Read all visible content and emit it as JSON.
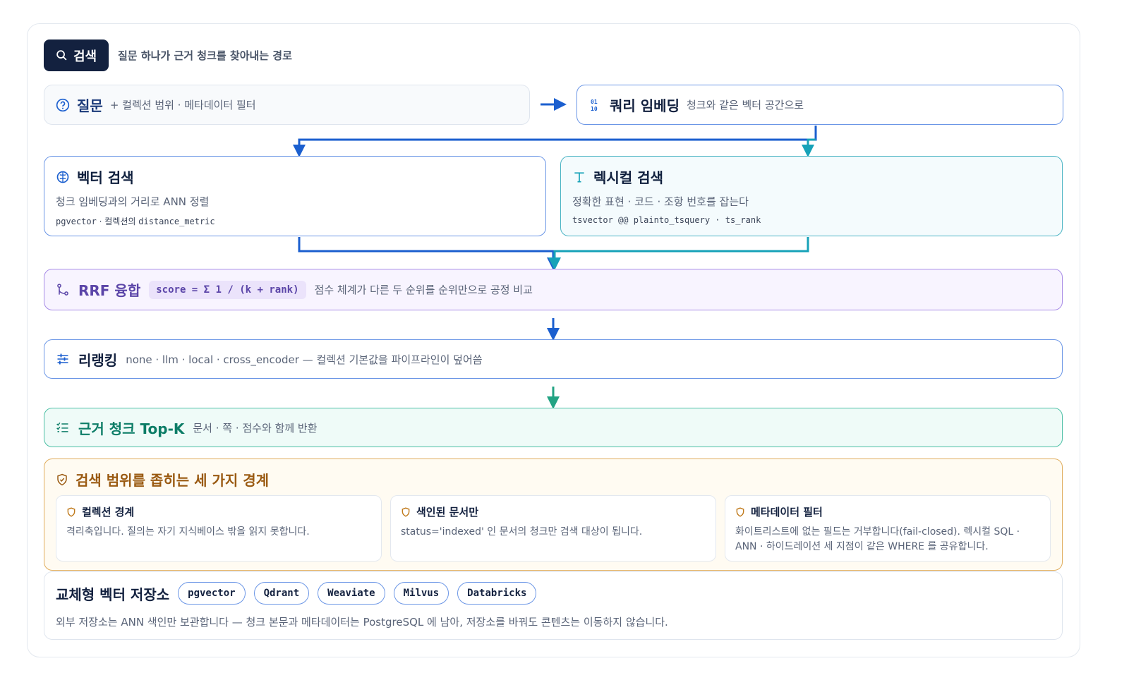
{
  "header": {
    "badge_label": "검색",
    "subtitle": "질문 하나가 근거 청크를 찾아내는 경로"
  },
  "question": {
    "title": "질문",
    "detail": "+ 컬렉션 범위 · 메타데이터 필터"
  },
  "query_embedding": {
    "title": "쿼리 임베딩",
    "detail": "청크와 같은 벡터 공간으로"
  },
  "vector_search": {
    "title": "벡터 검색",
    "detail": "청크 임베딩과의 거리로 ANN 정렬",
    "code_a": "pgvector",
    "code_b": "컬렉션의",
    "code_c": "distance_metric"
  },
  "lexical_search": {
    "title": "렉시컬 검색",
    "detail": "정확한 표현 · 코드 · 조항 번호를 잡는다",
    "code": "tsvector @@ plainto_tsquery · ts_rank"
  },
  "rrf": {
    "title": "RRF 융합",
    "formula": "score = Σ 1 / (k + rank)",
    "detail": "점수 체계가 다른 두 순위를 순위만으로 공정 비교"
  },
  "rerank": {
    "title": "리랭킹",
    "detail": "none · llm · local · cross_encoder — 컬렉션 기본값을 파이프라인이 덮어씀"
  },
  "topk": {
    "title": "근거 청크 Top-K",
    "detail": "문서 · 쪽 · 점수와 함께 반환"
  },
  "boundaries": {
    "title": "검색 범위를 좁히는 세 가지 경계",
    "cards": [
      {
        "title": "컬렉션 경계",
        "text": "격리축입니다. 질의는 자기 지식베이스 밖을 읽지 못합니다."
      },
      {
        "title": "색인된 문서만",
        "text": "status='indexed' 인 문서의 청크만 검색 대상이 됩니다."
      },
      {
        "title": "메타데이터 필터",
        "text": "화이트리스트에 없는 필드는 거부합니다(fail-closed). 렉시컬 SQL · ANN · 하이드레이션 세 지점이 같은 WHERE 를 공유합니다."
      }
    ]
  },
  "stores": {
    "title": "교체형 벡터 저장소",
    "items": [
      "pgvector",
      "Qdrant",
      "Weaviate",
      "Milvus",
      "Databricks"
    ],
    "note": "외부 저장소는 ANN 색인만 보관합니다 — 청크 본문과 메타데이터는 PostgreSQL 에 남아, 저장소를 바꿔도 콘텐츠는 이동하지 않습니다."
  },
  "colors": {
    "navy": "#13213f",
    "blue": "#1b5fcf",
    "teal": "#17a2b8",
    "purple": "#5b45a8",
    "green": "#0d7d67",
    "amber": "#9a5a12"
  },
  "icons": [
    "search-icon",
    "question-circle-icon",
    "binary-icon",
    "brain-icon",
    "type-icon",
    "merge-icon",
    "sliders-icon",
    "checklist-icon",
    "shield-icon"
  ]
}
